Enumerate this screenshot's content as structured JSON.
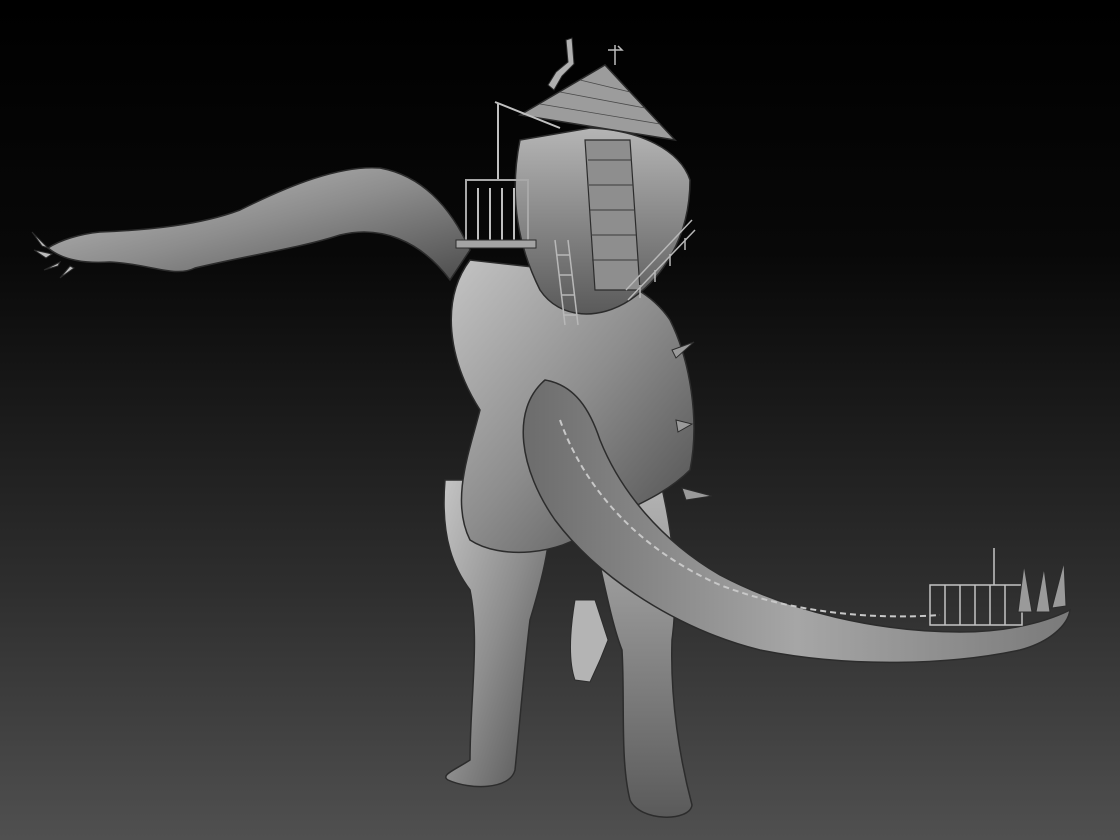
{
  "colors": {
    "bg_top": "#000000",
    "bg_bottom": "#505050",
    "clay_light": "#b9b9b9",
    "clay_mid": "#8a8a8a",
    "clay_dark": "#4a4a4a"
  }
}
